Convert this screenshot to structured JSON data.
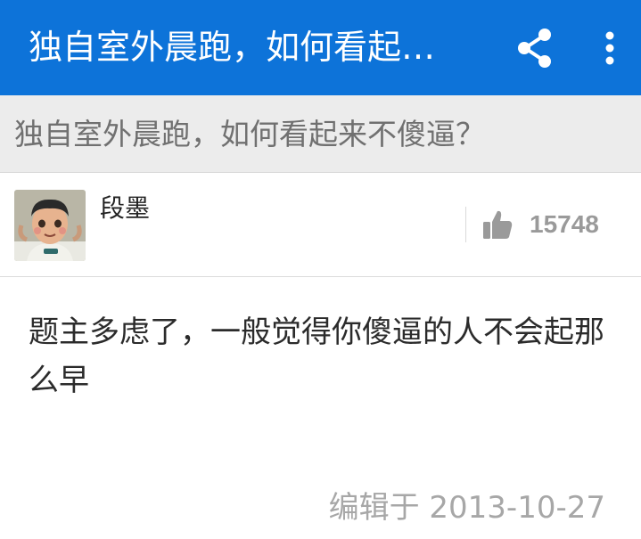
{
  "appbar": {
    "title": "独自室外晨跑，如何看起…",
    "share_icon": "share-icon",
    "more_icon": "more-vertical-icon",
    "background": "#0d73d9"
  },
  "question": {
    "title": "独自室外晨跑，如何看起来不傻逼？"
  },
  "author": {
    "name": "段墨",
    "avatar_icon": "avatar"
  },
  "vote": {
    "icon": "thumbs-up-icon",
    "count": "15748"
  },
  "answer": {
    "text": "题主多虑了，一般觉得你傻逼的人不会起那么早",
    "edited": "编辑于 2013-10-27"
  }
}
